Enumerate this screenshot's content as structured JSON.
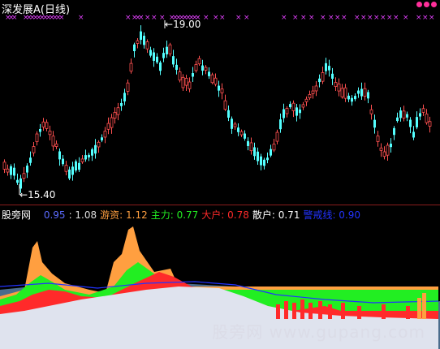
{
  "title": {
    "stock_name": "深发展A",
    "period": "(日线)"
  },
  "price_chart": {
    "type": "candlestick",
    "high_label": "19.00",
    "low_label": "15.40",
    "up_color": "#ff5050",
    "down_color": "#54ffff",
    "signal_marker": "×",
    "signal_color": "#e040fb"
  },
  "indicator": {
    "name": "股旁网",
    "values": [
      {
        "label": "",
        "value": "0.95",
        "color": "#5b6bff"
      },
      {
        "label": "",
        "value": "1.08",
        "color": "#dddddd"
      },
      {
        "label": "游资",
        "value": "1.12",
        "color": "#ff9f40"
      },
      {
        "label": "主力",
        "value": "0.77",
        "color": "#22ee22"
      },
      {
        "label": "大户",
        "value": "0.78",
        "color": "#ff2a2a"
      },
      {
        "label": "散户",
        "value": "0.71",
        "color": "#ffffff"
      },
      {
        "label": "警戒线",
        "value": "0.90",
        "color": "#2233ff"
      }
    ]
  },
  "watermark": "股旁网 www.gupang.com",
  "chart_data": {
    "type": "area",
    "series": [
      {
        "name": "游资",
        "color": "#ff9f40"
      },
      {
        "name": "主力",
        "color": "#22ee22"
      },
      {
        "name": "大户",
        "color": "#ff2a2a"
      },
      {
        "name": "散户",
        "color": "#dfe3ee"
      },
      {
        "name": "警戒线",
        "color": "#2233ff"
      }
    ]
  }
}
